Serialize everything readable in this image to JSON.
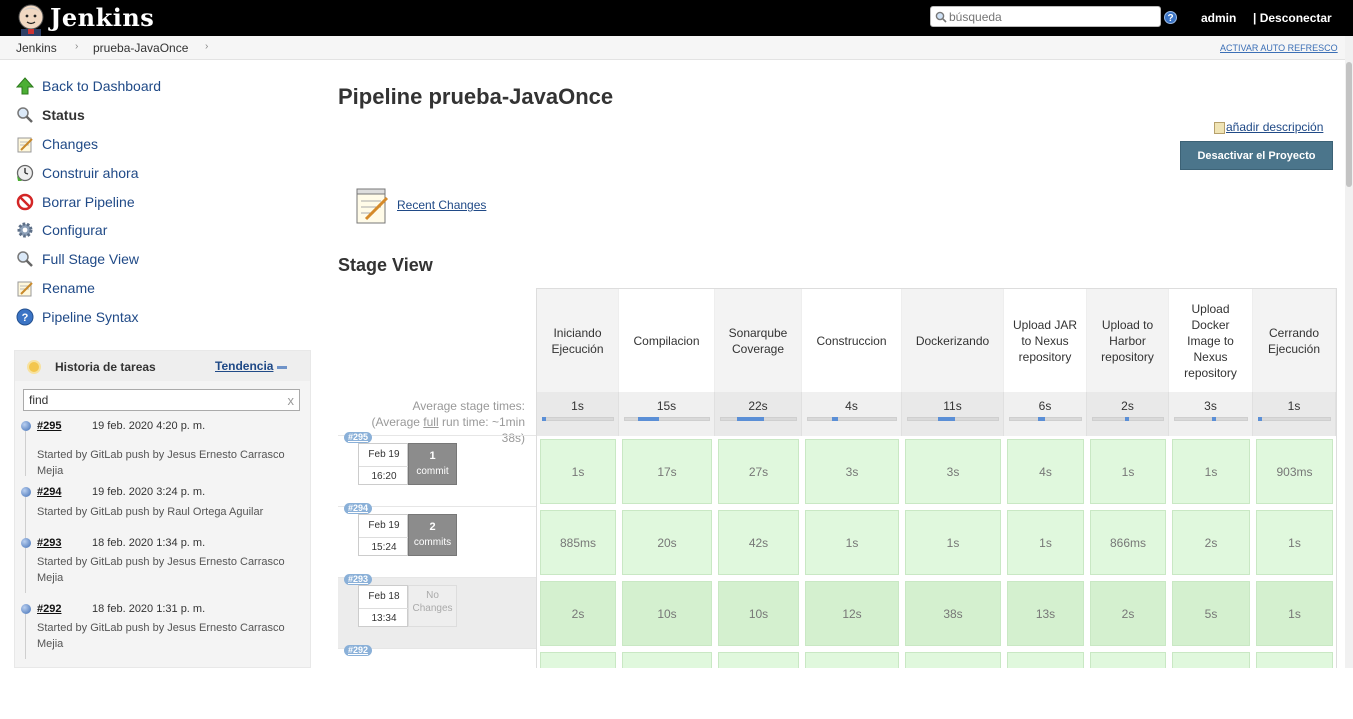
{
  "header": {
    "brand": "Jenkins",
    "search_placeholder": "búsqueda",
    "help": "?",
    "user": "admin",
    "logout": "| Desconectar"
  },
  "breadcrumbs": {
    "items": [
      "Jenkins",
      "prueba-JavaOnce"
    ],
    "auto_refresh": "ACTIVAR AUTO REFRESCO"
  },
  "sidebar": {
    "tasks": [
      {
        "label": "Back to Dashboard",
        "icon": "up-arrow-icon"
      },
      {
        "label": "Status",
        "icon": "magnifier-icon"
      },
      {
        "label": "Changes",
        "icon": "notepad-icon"
      },
      {
        "label": "Construir ahora",
        "icon": "clock-build-icon"
      },
      {
        "label": "Borrar Pipeline",
        "icon": "no-entry-icon"
      },
      {
        "label": "Configurar",
        "icon": "gear-icon"
      },
      {
        "label": "Full Stage View",
        "icon": "magnifier-icon"
      },
      {
        "label": "Rename",
        "icon": "notepad-icon"
      },
      {
        "label": "Pipeline Syntax",
        "icon": "help-icon"
      }
    ],
    "history": {
      "title": "Historia de tareas",
      "trend": "Tendencia",
      "filter_value": "find",
      "filter_clear": "x",
      "builds": [
        {
          "number": "#295",
          "date": "19 feb. 2020 4:20 p. m.",
          "cause": "Started by GitLab push by Jesus Ernesto Carrasco Mejia"
        },
        {
          "number": "#294",
          "date": "19 feb. 2020 3:24 p. m.",
          "cause": "Started by GitLab push by Raul Ortega Aguilar"
        },
        {
          "number": "#293",
          "date": "18 feb. 2020 1:34 p. m.",
          "cause": "Started by GitLab push by Jesus Ernesto Carrasco Mejia"
        },
        {
          "number": "#292",
          "date": "18 feb. 2020 1:31 p. m.",
          "cause": "Started by GitLab push by Jesus Ernesto Carrasco Mejia"
        }
      ]
    }
  },
  "main": {
    "title": "Pipeline prueba-JavaOnce",
    "add_description": "añadir descripción",
    "disable_button": "Desactivar el Proyecto",
    "recent_changes": "Recent Changes",
    "stage_view_title": "Stage View",
    "avg_label_1": "Average stage times:",
    "avg_label_2a": "(Average ",
    "avg_label_2b": "full",
    "avg_label_2c": " run time: ~1min",
    "avg_label_3": "38s)"
  },
  "stage_view": {
    "stages": [
      {
        "name": "Iniciando Ejecución",
        "avg": "1s",
        "avg_fraction": 0.0
      },
      {
        "name": "Compilacion",
        "avg": "15s",
        "avg_fraction": 0.25
      },
      {
        "name": "Sonarqube Coverage",
        "avg": "22s",
        "avg_fraction": 0.35
      },
      {
        "name": "Construccion",
        "avg": "4s",
        "avg_fraction": 0.06
      },
      {
        "name": "Dockerizando",
        "avg": "11s",
        "avg_fraction": 0.18
      },
      {
        "name": "Upload JAR to Nexus repository",
        "avg": "6s",
        "avg_fraction": 0.1
      },
      {
        "name": "Upload to Harbor repository",
        "avg": "2s",
        "avg_fraction": 0.03
      },
      {
        "name": "Upload Docker Image to Nexus repository",
        "avg": "3s",
        "avg_fraction": 0.05
      },
      {
        "name": "Cerrando Ejecución",
        "avg": "1s",
        "avg_fraction": 0.0
      }
    ],
    "builds": [
      {
        "number": "#295",
        "date": "Feb 19",
        "time": "16:20",
        "changes_count": "1",
        "changes_word": "commit",
        "times": [
          "1s",
          "17s",
          "27s",
          "3s",
          "3s",
          "4s",
          "1s",
          "1s",
          "903ms"
        ]
      },
      {
        "number": "#294",
        "date": "Feb 19",
        "time": "15:24",
        "changes_count": "2",
        "changes_word": "commits",
        "times": [
          "885ms",
          "20s",
          "42s",
          "1s",
          "1s",
          "1s",
          "866ms",
          "2s",
          "1s"
        ]
      },
      {
        "number": "#293",
        "date": "Feb 18",
        "time": "13:34",
        "changes_count": "No",
        "changes_word": "Changes",
        "times": [
          "2s",
          "10s",
          "10s",
          "12s",
          "38s",
          "13s",
          "2s",
          "5s",
          "1s"
        ]
      },
      {
        "number": "#292",
        "date": "",
        "time": "",
        "changes_count": "",
        "changes_word": "",
        "times": [
          "",
          "",
          "",
          "",
          "",
          "",
          "",
          "",
          ""
        ]
      }
    ],
    "colors": {
      "success": "#e0f8dd",
      "success_dark": "#d4f0cf",
      "bar": "#5b8fd6"
    }
  }
}
